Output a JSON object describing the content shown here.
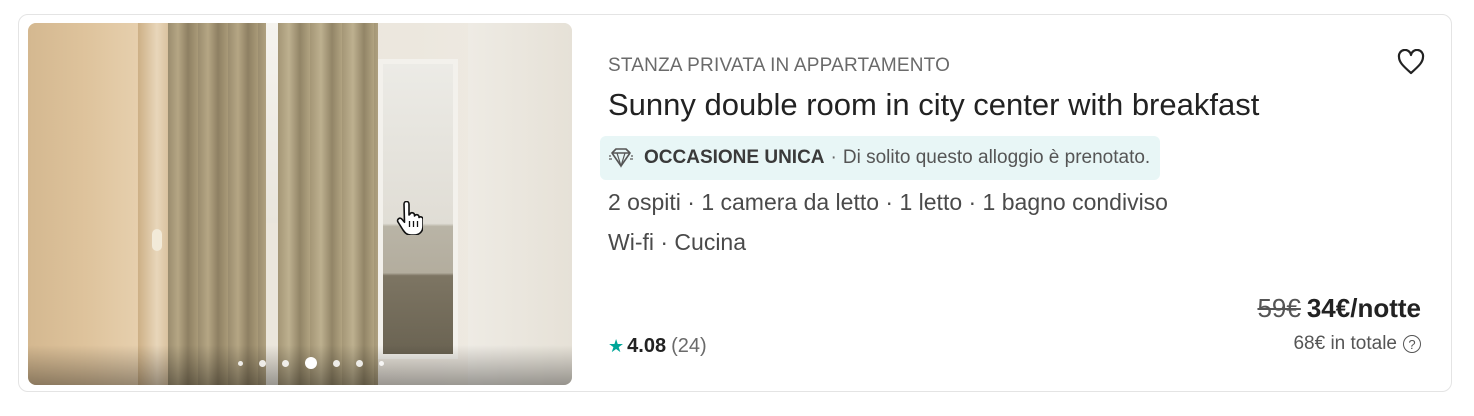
{
  "listing": {
    "room_type": "STANZA PRIVATA IN APPARTAMENTO",
    "title": "Sunny double room in city center with breakfast",
    "deal": {
      "label": "OCCASIONE UNICA",
      "separator": "·",
      "note": "Di solito questo alloggio è prenotato.",
      "icon": "gem-icon"
    },
    "features": "2 ospiti · 1 camera da letto · 1 letto · 1 bagno condiviso",
    "amenities": "Wi-fi · Cucina",
    "rating": {
      "star": "★",
      "score": "4.08",
      "count": "(24)"
    },
    "price": {
      "old": "59€",
      "new": "34€/notte",
      "total": "68€ in totale",
      "help": "?"
    },
    "carousel": {
      "dot_count": 7,
      "active_index": 3
    },
    "favorite_icon": "heart-icon"
  },
  "colors": {
    "accent_teal": "#00a699",
    "deal_bg": "#e8f6f6",
    "text_primary": "#222222",
    "text_secondary": "#6a6a6a"
  }
}
